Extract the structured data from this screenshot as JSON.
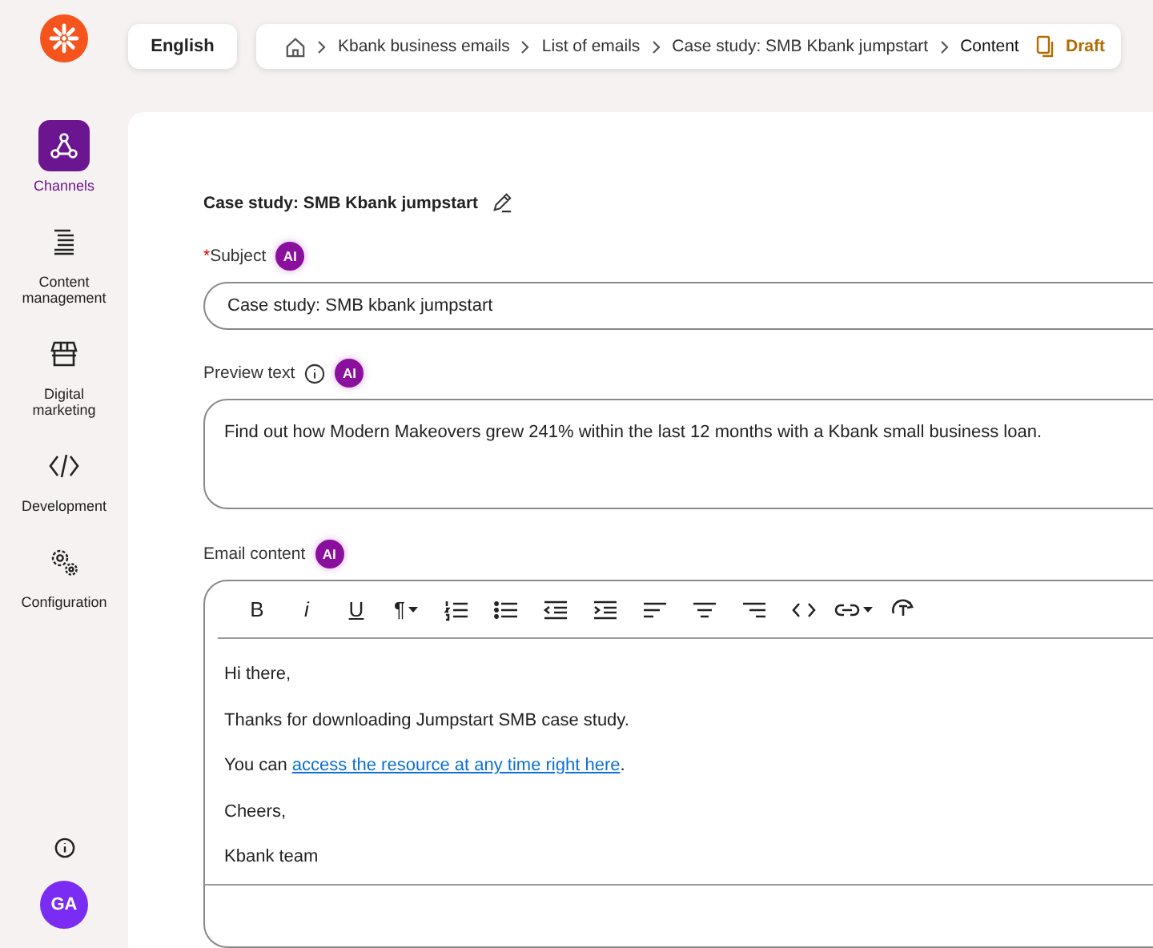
{
  "sidebar": {
    "items": [
      {
        "label": "Channels",
        "kind": "channels",
        "selected": true
      },
      {
        "label": "Content management",
        "kind": "content",
        "selected": false
      },
      {
        "label": "Digital marketing",
        "kind": "store",
        "selected": false
      },
      {
        "label": "Development",
        "kind": "code",
        "selected": false
      },
      {
        "label": "Configuration",
        "kind": "gears",
        "selected": false
      }
    ],
    "avatar": "GA"
  },
  "language": "English",
  "breadcrumb": {
    "items": [
      "Kbank business emails",
      "List of emails",
      "Case study: SMB Kbank jumpstart",
      "Content"
    ],
    "status": "Draft"
  },
  "form": {
    "title": "Case study: SMB Kbank jumpstart",
    "fields": [
      {
        "label": "Subject",
        "required_mark": "*",
        "info": false,
        "ai": "AI",
        "kind": "input",
        "value": "Case study: SMB kbank jumpstart"
      },
      {
        "label": "Preview text",
        "info": true,
        "ai": "AI",
        "kind": "textarea",
        "value": "Find out how Modern Makeovers grew 241% within the last 12 months with a Kbank small business loan."
      },
      {
        "label": "Email content",
        "info": false,
        "ai": "AI",
        "kind": "editor"
      }
    ],
    "toolbar": [
      {
        "kind": "bold",
        "label": "B",
        "menu": false
      },
      {
        "kind": "italic",
        "label": "i",
        "menu": false
      },
      {
        "kind": "underline",
        "label": "U",
        "menu": false
      },
      {
        "kind": "paragraph",
        "label": "¶",
        "menu": true
      },
      {
        "kind": "ordered",
        "menu": false
      },
      {
        "kind": "bullets",
        "menu": false
      },
      {
        "kind": "outdent",
        "menu": false
      },
      {
        "kind": "indent",
        "menu": false
      },
      {
        "kind": "left",
        "menu": false
      },
      {
        "kind": "center",
        "menu": false
      },
      {
        "kind": "right",
        "menu": false
      },
      {
        "kind": "code",
        "menu": false
      },
      {
        "kind": "link",
        "menu": true
      },
      {
        "kind": "clear",
        "menu": false
      }
    ],
    "body": [
      [
        {
          "text": "Hi there,",
          "link": false
        }
      ],
      [
        {
          "text": "Thanks for downloading Jumpstart SMB case study.",
          "link": false
        }
      ],
      [
        {
          "text": "You can ",
          "link": false
        },
        {
          "text": "access the resource at any time right here",
          "link": true
        },
        {
          "text": ".",
          "link": false
        }
      ],
      [
        {
          "text": "Cheers,",
          "link": false
        }
      ],
      [
        {
          "text": "Kbank team",
          "link": false
        }
      ]
    ]
  }
}
